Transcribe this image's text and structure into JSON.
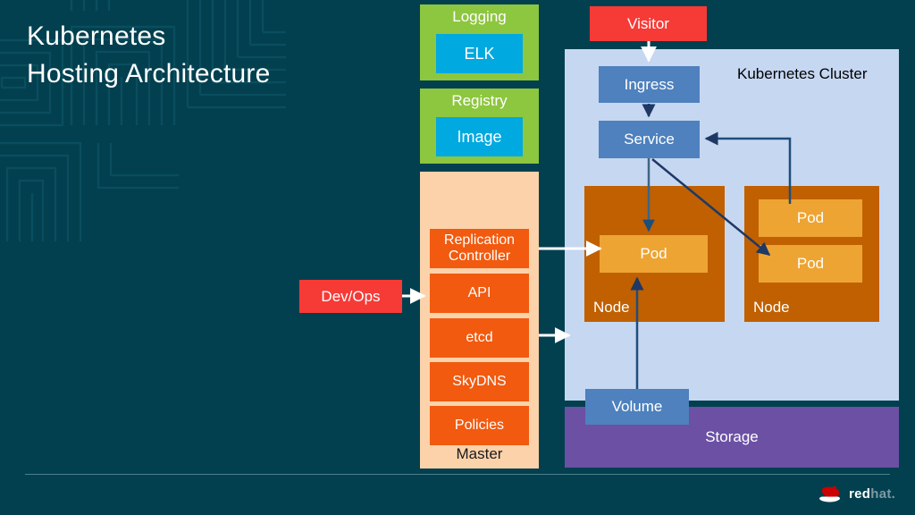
{
  "slide": {
    "title": "Kubernetes\nHosting Architecture",
    "background_color": "#03404f",
    "footer_logo": {
      "icon": "redhat-fedora-icon",
      "word_primary": "red",
      "word_secondary": "hat."
    }
  },
  "side_stack": {
    "logging": {
      "title": "Logging",
      "inner_label": "ELK",
      "panel_color": "#8dc63f",
      "inner_color": "#00a9e0"
    },
    "registry": {
      "title": "Registry",
      "inner_label": "Image",
      "panel_color": "#8dc63f",
      "inner_color": "#00a9e0"
    },
    "master": {
      "label": "Master",
      "panel_color": "#fcd2aa",
      "item_color": "#f15a0f",
      "items": [
        {
          "label": "Replication\nController"
        },
        {
          "label": "API"
        },
        {
          "label": "etcd"
        },
        {
          "label": "SkyDNS"
        },
        {
          "label": "Policies"
        }
      ]
    }
  },
  "actors": {
    "devops": {
      "label": "Dev/Ops",
      "color": "#f63a36"
    },
    "visitor": {
      "label": "Visitor",
      "color": "#f63a36"
    }
  },
  "cluster": {
    "label": "Kubernetes Cluster",
    "background_color": "#c6d7f2",
    "ingress": {
      "label": "Ingress",
      "color": "#4e81bd"
    },
    "service": {
      "label": "Service",
      "color": "#4e81bd"
    },
    "volume": {
      "label": "Volume",
      "color": "#4e81bd"
    },
    "nodes": [
      {
        "label": "Node",
        "color": "#c06000",
        "pods": [
          {
            "label": "Pod"
          }
        ]
      },
      {
        "label": "Node",
        "color": "#c06000",
        "pods": [
          {
            "label": "Pod"
          },
          {
            "label": "Pod"
          }
        ]
      }
    ]
  },
  "storage": {
    "label": "Storage",
    "color": "#6b50a4"
  }
}
